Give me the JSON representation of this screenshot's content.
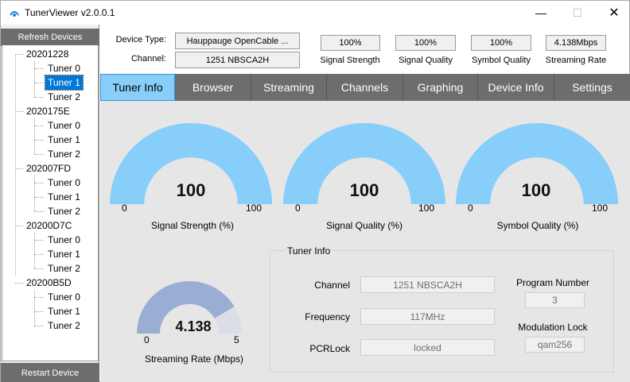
{
  "window": {
    "title": "TunerViewer v2.0.0.1",
    "minimize": "—",
    "maximize": "☐",
    "close": "✕"
  },
  "sidebar": {
    "refresh_label": "Refresh Devices",
    "restart_label": "Restart Device",
    "devices": [
      {
        "name": "20201228",
        "tuners": [
          "Tuner 0",
          "Tuner 1",
          "Tuner 2"
        ]
      },
      {
        "name": "2020175E",
        "tuners": [
          "Tuner 0",
          "Tuner 1",
          "Tuner 2"
        ]
      },
      {
        "name": "202007FD",
        "tuners": [
          "Tuner 0",
          "Tuner 1",
          "Tuner 2"
        ]
      },
      {
        "name": "20200D7C",
        "tuners": [
          "Tuner 0",
          "Tuner 1",
          "Tuner 2"
        ]
      },
      {
        "name": "20200B5D",
        "tuners": [
          "Tuner 0",
          "Tuner 1",
          "Tuner 2"
        ]
      }
    ],
    "selected": "20201228 / Tuner 1"
  },
  "header": {
    "device_type_label": "Device Type:",
    "device_type_value": "Hauppauge OpenCable ...",
    "channel_label": "Channel:",
    "channel_value": "1251 NBSCA2H",
    "stats": [
      {
        "value": "100%",
        "caption": "Signal Strength"
      },
      {
        "value": "100%",
        "caption": "Signal Quality"
      },
      {
        "value": "100%",
        "caption": "Symbol Quality"
      },
      {
        "value": "4.138Mbps",
        "caption": "Streaming Rate"
      }
    ]
  },
  "tabs": [
    {
      "label": "Tuner Info",
      "active": true
    },
    {
      "label": "Browser",
      "active": false
    },
    {
      "label": "Streaming",
      "active": false
    },
    {
      "label": "Channels",
      "active": false
    },
    {
      "label": "Graphing",
      "active": false
    },
    {
      "label": "Device Info",
      "active": false
    },
    {
      "label": "Settings",
      "active": false
    }
  ],
  "gauges": [
    {
      "id": "signal-strength",
      "value": 100,
      "display": "100",
      "min": 0,
      "max": 100,
      "min_label": "0",
      "max_label": "100",
      "caption": "Signal Strength (%)"
    },
    {
      "id": "signal-quality",
      "value": 100,
      "display": "100",
      "min": 0,
      "max": 100,
      "min_label": "0",
      "max_label": "100",
      "caption": "Signal Quality (%)"
    },
    {
      "id": "symbol-quality",
      "value": 100,
      "display": "100",
      "min": 0,
      "max": 100,
      "min_label": "0",
      "max_label": "100",
      "caption": "Symbol Quality (%)"
    },
    {
      "id": "streaming-rate",
      "value": 4.138,
      "display": "4.138",
      "min": 0,
      "max": 5,
      "min_label": "0",
      "max_label": "5",
      "caption": "Streaming Rate (Mbps)"
    }
  ],
  "tuner_info": {
    "title": "Tuner Info",
    "channel_label": "Channel",
    "channel_value": "1251 NBSCA2H",
    "frequency_label": "Frequency",
    "frequency_value": "117MHz",
    "pcrlock_label": "PCRLock",
    "pcrlock_value": "locked",
    "program_number_label": "Program Number",
    "program_number_value": "3",
    "modulation_lock_label": "Modulation Lock",
    "modulation_lock_value": "qam256"
  },
  "colors": {
    "gauge_fill": "#87cefa",
    "rate_fill": "#9aaed3",
    "rate_track": "#d9dee7",
    "tab_bar": "#6d6d6d",
    "tab_active": "#87cefa",
    "selection": "#0078d7"
  }
}
